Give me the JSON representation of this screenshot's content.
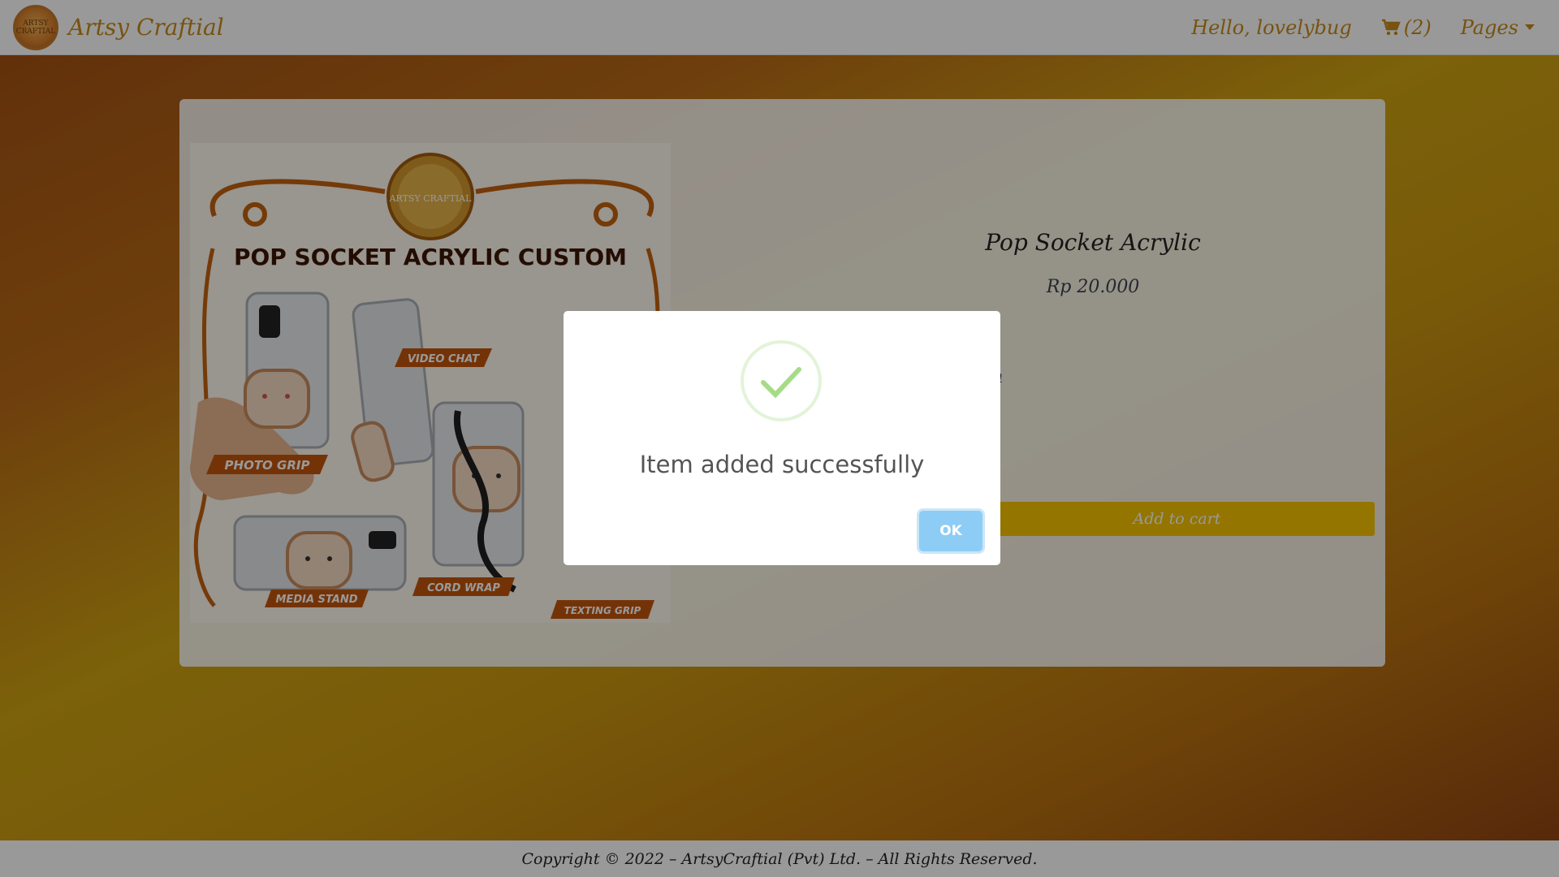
{
  "navbar": {
    "brand_name": "Artsy Craftial",
    "logo_text": "ARTSY CRAFTIAL",
    "greeting": "Hello, lovelybug",
    "cart_count": "(2)",
    "pages_label": "Pages"
  },
  "product": {
    "image_banner": "POP SOCKET ACRYLIC CUSTOM",
    "image_logo_text": "ARTSY CRAFTIAL",
    "image_labels": {
      "video_chat": "VIDEO CHAT",
      "photo_grip": "PHOTO GRIP",
      "media_stand": "MEDIA STAND",
      "cord_wrap": "CORD WRAP",
      "texting_grip": "TEXTING GRIP"
    },
    "title": "Pop Socket Acrylic",
    "price": "Rp 20.000",
    "partial_text": "n",
    "add_to_cart_label": "Add to cart"
  },
  "footer": {
    "copyright": "Copyright © 2022 – ArtsyCraftial (Pvt) Ltd. – All Rights Reserved."
  },
  "modal": {
    "message": "Item added successfully",
    "ok_label": "OK",
    "icon": "success-check-icon"
  },
  "colors": {
    "accent_gold": "#c78a1a",
    "button_yellow": "#f5c400",
    "ok_blue": "#8dcdf5",
    "check_green": "#a5dc86"
  }
}
